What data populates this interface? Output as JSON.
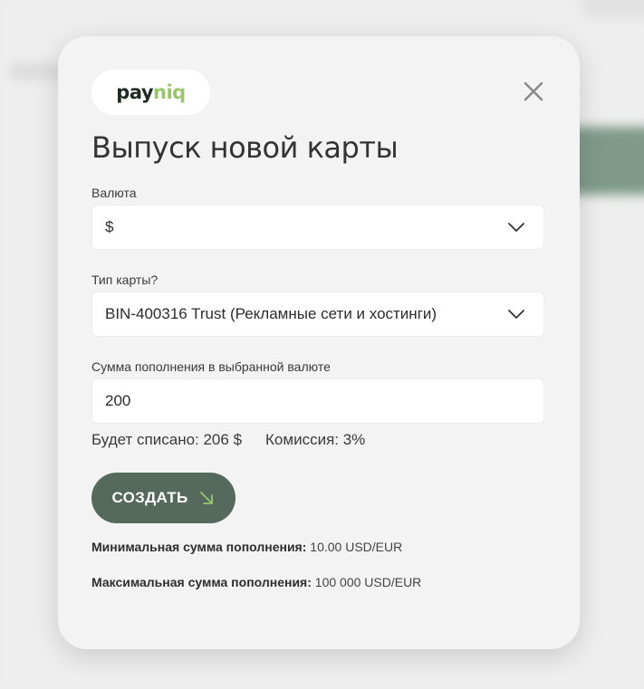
{
  "modal": {
    "logo": {
      "part1": "pay",
      "part2": "niq",
      "color1": "#1f2a24",
      "color2": "#9ac56f"
    },
    "close_icon": "close-icon",
    "title": "Выпуск новой карты",
    "currency": {
      "label": "Валюта",
      "selected": "$"
    },
    "card_type": {
      "label": "Тип карты?",
      "selected": "BIN-400316 Trust (Рекламные сети и хостинги)"
    },
    "amount": {
      "label": "Сумма пополнения в выбранной валюте",
      "value": "200"
    },
    "summary": {
      "charged": "Будет списано: 206 $",
      "commission": "Комиссия: 3%"
    },
    "create_button": {
      "label": "СОЗДАТЬ",
      "icon": "arrow-down-right-icon",
      "bg_color": "#55695c",
      "icon_color": "#9ac56f"
    },
    "limits": {
      "min_label": "Минимальная сумма пополнения:",
      "min_value": "10.00 USD/EUR",
      "max_label": "Максимальная сумма пополнения:",
      "max_value": "100 000 USD/EUR"
    }
  }
}
